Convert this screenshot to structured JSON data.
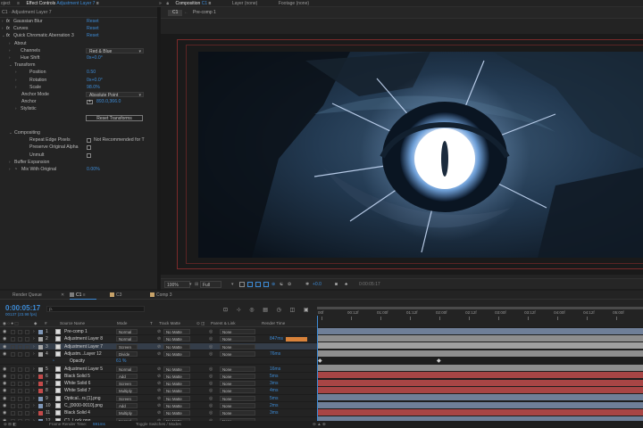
{
  "top_tabs": {
    "left_fragment": "oject",
    "effect_controls_prefix": "Effect Controls",
    "effect_controls_layer": "Adjustment Layer 7",
    "composition_prefix": "Composition",
    "composition_name": "C1",
    "layer_tab": "Layer (none)",
    "footage_tab": "Footage (none)"
  },
  "effect_controls": {
    "breadcrumb": "C1 · Adjustment Layer 7",
    "effects": [
      {
        "name": "Gaussian Blur",
        "reset": "Reset"
      },
      {
        "name": "Curves",
        "reset": "Reset"
      },
      {
        "name": "Quick Chromatic Aberration 3",
        "reset": "Reset"
      }
    ],
    "about": "About",
    "channels_label": "Channels",
    "channels_value": "Red & Blue",
    "hue_shift_label": "Hue Shift",
    "hue_shift_value": "0x+0.0°",
    "transform_label": "Transform",
    "position_label": "Position",
    "position_value": "0.50",
    "rotation_label": "Rotation",
    "rotation_value": "0x+0.0°",
    "scale_label": "Scale",
    "scale_value": "98.0%",
    "anchor_mode_label": "Anchor Mode",
    "anchor_mode_value": "Absolute Point",
    "anchor_label": "Anchor",
    "anchor_value": "893.0,366.0",
    "stylistic_label": "Stylistic",
    "reset_transforms": "Reset Transforms",
    "compositing_label": "Compositing",
    "repeat_edge_label": "Repeat Edge Pixels",
    "repeat_edge_note": "Not Recommended for T",
    "preserve_alpha_label": "Preserve Original Alpha",
    "unmult_label": "Unmult",
    "buffer_expansion_label": "Buffer Expansion",
    "mix_label": "Mix With Original",
    "mix_value": "0.00%"
  },
  "composition": {
    "subtabs": [
      "C1",
      "Pre-comp 1"
    ],
    "zoom": "100%",
    "resolution": "Full",
    "exposure": "+0.0",
    "timecode": "0:00:05:17"
  },
  "timeline": {
    "tabs": [
      {
        "label": "Render Queue",
        "color": ""
      },
      {
        "label": "C1",
        "color": "#7d7d7d"
      },
      {
        "label": "C3",
        "color": "#c8a36a"
      },
      {
        "label": "Comp 3",
        "color": "#c8a36a"
      }
    ],
    "current_time": "0:00:05:17",
    "fps": "00137 (23.98 fps)",
    "search_placeholder": "ρ.",
    "headers": {
      "source_name": "Source Name",
      "mode": "Mode",
      "t": "T",
      "track_matte": "Track Matte",
      "parent": "Parent & Link",
      "render_time": "Render Time"
    },
    "layers": [
      {
        "num": "1",
        "name": "Pre-comp 1",
        "mode": "Normal",
        "matte": "No Matte",
        "parent": "None",
        "render": "",
        "color": "#7f97b8",
        "selected": false
      },
      {
        "num": "2",
        "name": "Adjustment Layer 8",
        "mode": "Normal",
        "matte": "No Matte",
        "parent": "None",
        "render": "847ms",
        "color": "#a8a8a8",
        "selected": false
      },
      {
        "num": "3",
        "name": "Adjustment Layer 7",
        "mode": "Screen",
        "matte": "No Matte",
        "parent": "None",
        "render": "",
        "color": "#a8a8a8",
        "selected": true
      },
      {
        "num": "4",
        "name": "Adjustm...Layer 12",
        "mode": "Divide",
        "matte": "No Matte",
        "parent": "None",
        "render": "76ms",
        "color": "#a8a8a8",
        "selected": false
      },
      {
        "num": "",
        "name": "Opacity",
        "mode": "",
        "matte": "",
        "parent": "",
        "render": "",
        "color": "",
        "selected": false,
        "value": "61 %"
      },
      {
        "num": "5",
        "name": "Adjustment Layer 5",
        "mode": "Normal",
        "matte": "No Matte",
        "parent": "None",
        "render": "16ms",
        "color": "#a8a8a8",
        "selected": false
      },
      {
        "num": "6",
        "name": "Black Solid 5",
        "mode": "Add",
        "matte": "No Matte",
        "parent": "None",
        "render": "5ms",
        "color": "#c34a4a",
        "selected": false
      },
      {
        "num": "7",
        "name": "White Solid 6",
        "mode": "Screen",
        "matte": "No Matte",
        "parent": "None",
        "render": "3ms",
        "color": "#c34a4a",
        "selected": false
      },
      {
        "num": "8",
        "name": "White Solid 7",
        "mode": "Multiply",
        "matte": "No Matte",
        "parent": "None",
        "render": "4ms",
        "color": "#c34a4a",
        "selected": false
      },
      {
        "num": "9",
        "name": "Optical...rs [1].png",
        "mode": "Screen",
        "matte": "No Matte",
        "parent": "None",
        "render": "5ms",
        "color": "#7f97b8",
        "selected": false
      },
      {
        "num": "10",
        "name": "C_[0000-0010].png",
        "mode": "Add",
        "matte": "No Matte",
        "parent": "None",
        "render": "2ms",
        "color": "#7f97b8",
        "selected": false
      },
      {
        "num": "11",
        "name": "Black Solid 4",
        "mode": "Multiply",
        "matte": "No Matte",
        "parent": "None",
        "render": "3ms",
        "color": "#c34a4a",
        "selected": false
      },
      {
        "num": "12",
        "name": "C1, Lock.png",
        "mode": "Normal",
        "matte": "No Matte",
        "parent": "None",
        "render": "",
        "color": "#7f97b8",
        "selected": false
      }
    ],
    "ruler_ticks": [
      "00f",
      "00:12f",
      "01:00f",
      "01:12f",
      "02:00f",
      "02:12f",
      "03:00f",
      "03:12f",
      "04:00f",
      "04:12f",
      "05:00f"
    ],
    "status_render_label": "Frame Render Time:",
    "status_render_value": "591ms",
    "status_toggle": "Toggle Switches / Modes"
  },
  "colors": {
    "accent": "#3d8bd6",
    "panel": "#232323",
    "label_red": "#c34a4a",
    "label_grey": "#a8a8a8",
    "label_blue": "#7f97b8",
    "label_orange": "#d8823a"
  }
}
